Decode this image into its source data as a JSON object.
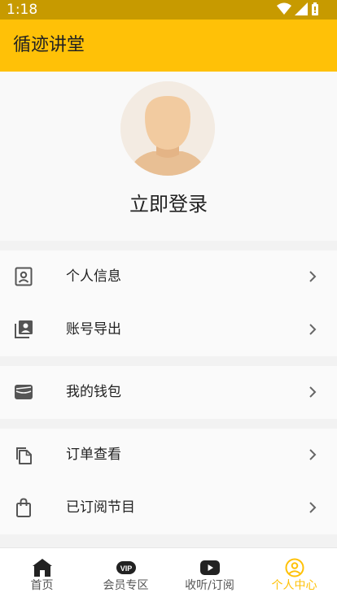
{
  "status": {
    "time": "1:18"
  },
  "app": {
    "title": "循迹讲堂"
  },
  "profile": {
    "login_label": "立即登录"
  },
  "menu": {
    "groups": [
      {
        "items": [
          {
            "label": "个人信息",
            "icon": "contact-card-icon"
          },
          {
            "label": "账号导出",
            "icon": "account-export-icon"
          }
        ]
      },
      {
        "items": [
          {
            "label": "我的钱包",
            "icon": "wallet-icon"
          }
        ]
      },
      {
        "items": [
          {
            "label": "订单查看",
            "icon": "copy-icon"
          },
          {
            "label": "已订阅节目",
            "icon": "shopping-bag-icon"
          }
        ]
      }
    ]
  },
  "nav": {
    "items": [
      {
        "label": "首页",
        "icon": "home-icon"
      },
      {
        "label": "会员专区",
        "icon": "vip-icon"
      },
      {
        "label": "收听/订阅",
        "icon": "play-icon"
      },
      {
        "label": "个人中心",
        "icon": "user-circle-icon",
        "active": true
      }
    ]
  },
  "colors": {
    "accent": "#ffc107",
    "status_bar": "#c79a00"
  }
}
